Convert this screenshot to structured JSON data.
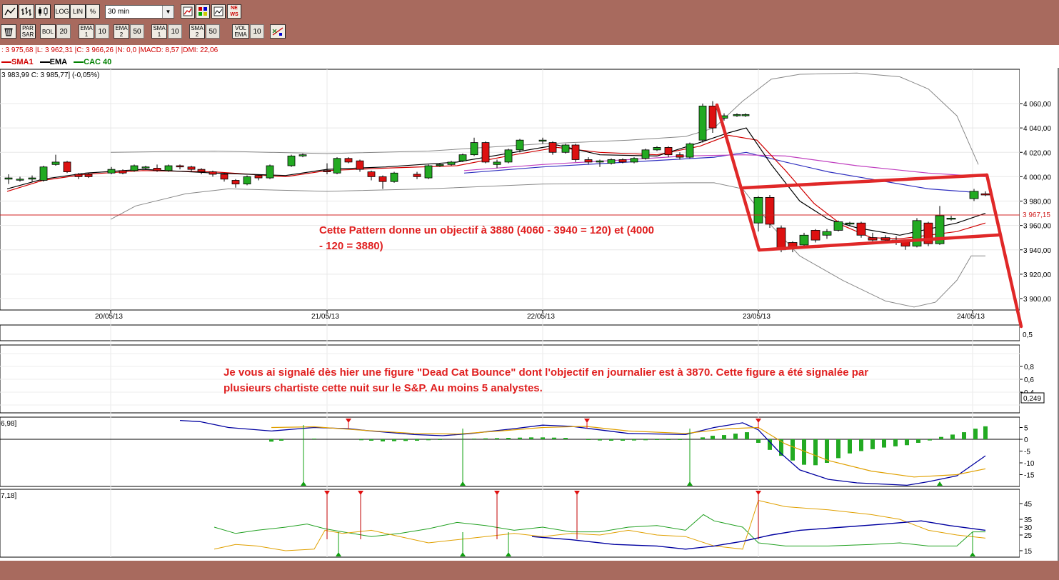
{
  "toolbar1": {
    "buttons": [
      {
        "label": "",
        "icon": "line-chart-icon"
      },
      {
        "label": "",
        "icon": "bar-chart-icon"
      },
      {
        "label": "",
        "icon": "candlestick-icon"
      },
      {
        "label": "LOG"
      },
      {
        "label": "LIN"
      },
      {
        "label": "%"
      }
    ],
    "timeframe": "30 min",
    "right_icons": [
      "compare-icon",
      "colors-icon",
      "chart-settings-icon",
      "news-icon"
    ],
    "news_label": "NE WS"
  },
  "toolbar2": {
    "items": [
      {
        "label": "PAR SAR"
      },
      {
        "label": "BOL",
        "value": "20"
      },
      {
        "label": "EMA 1",
        "value": "10"
      },
      {
        "label": "EMA 2",
        "value": "50"
      },
      {
        "label": "SMA 1",
        "value": "10"
      },
      {
        "label": "SMA 2",
        "value": "50"
      },
      {
        "label": "VOL EMA",
        "value": "10"
      }
    ]
  },
  "infobar": ": 3 975,68 |L: 3 962,31 |C: 3 966,26 |N: 0,0 |MACD: 8,57 |DMI: 22,06",
  "legend": {
    "sma1": "SMA1",
    "ema": "EMA",
    "cac": "CAC 40",
    "sma1_color": "#d00000",
    "ema_color": "#000000",
    "cac_color": "#008000"
  },
  "price_header": "3 983,99  C: 3 985,77] (-0,05%)",
  "price_axis": [
    "4 060,00",
    "4 040,00",
    "4 020,00",
    "4 000,00",
    "3 980,00",
    "3 960,00",
    "3 940,00",
    "3 920,00",
    "3 900,00"
  ],
  "current_price": "3 967,15",
  "dates": [
    "20/05/13",
    "21/05/13",
    "22/05/13",
    "23/05/13",
    "24/05/13"
  ],
  "annotation_pattern": [
    "Cette Pattern donne un objectif à 3880 (4060 - 3940 = 120) et (4000",
    "- 120 = 3880)"
  ],
  "annotation_dcb": [
    "Je vous ai signalé dès hier une figure \"Dead Cat Bounce\" dont l'objectif en journalier est à 3870. Cette figure a été signalée par",
    "plusieurs chartiste cette nuit sur le S&P. Au moins 5 analystes."
  ],
  "vol_axis": [
    "0,5"
  ],
  "osc_axis": [
    "0,8",
    "0,6",
    "0,4"
  ],
  "osc_value": "0,249",
  "macd_header": "6,98]",
  "macd_axis": [
    "5",
    "0",
    "-5",
    "-10",
    "-15"
  ],
  "dmi_header": "7,18]",
  "dmi_axis": [
    "45",
    "35",
    "30",
    "25",
    "15"
  ],
  "colors": {
    "frame": "#a86a5e",
    "up": "#22aa22",
    "down": "#dd1111",
    "annotation": "#e02020",
    "channel": "#e02828"
  }
}
